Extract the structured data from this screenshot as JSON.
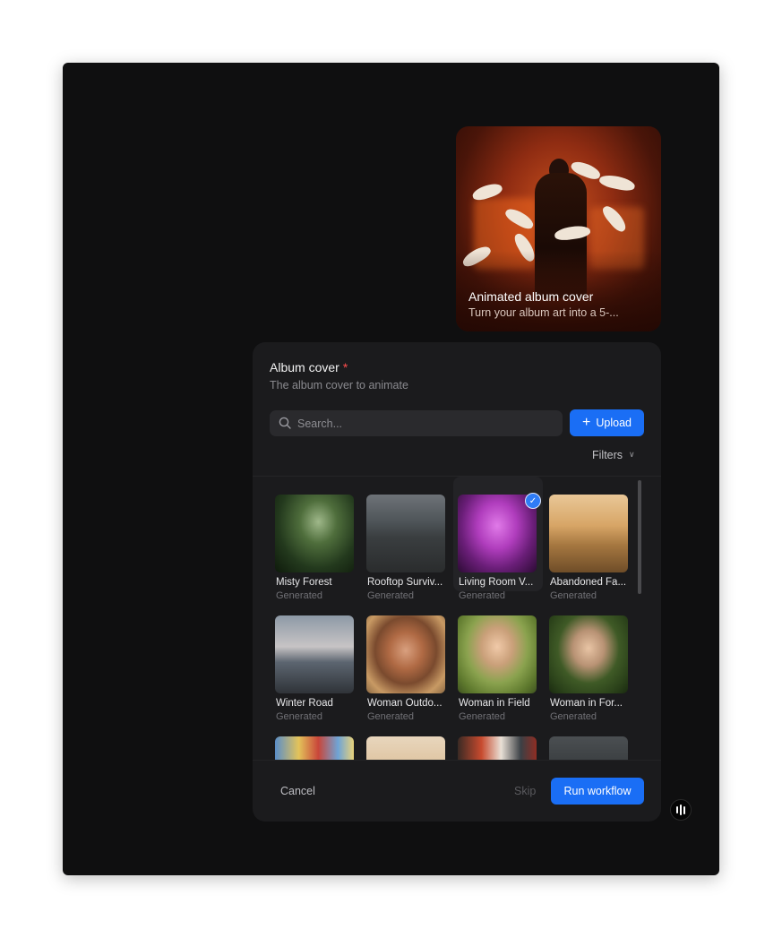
{
  "hero": {
    "title": "Animated album cover",
    "subtitle": "Turn your album art into a 5-..."
  },
  "form": {
    "field_label": "Album cover",
    "required_mark": "*",
    "field_description": "The album cover to animate",
    "search_placeholder": "Search...",
    "upload_label": "Upload",
    "filters_label": "Filters"
  },
  "gallery": {
    "items": [
      {
        "name": "Misty Forest",
        "source": "Generated",
        "selected": false,
        "icon": "forest-thumbnail"
      },
      {
        "name": "Rooftop Surviv...",
        "source": "Generated",
        "selected": false,
        "icon": "rooftop-thumbnail"
      },
      {
        "name": "Living Room V...",
        "source": "Generated",
        "selected": true,
        "icon": "living-room-thumbnail"
      },
      {
        "name": "Abandoned Fa...",
        "source": "Generated",
        "selected": false,
        "icon": "farmhouse-thumbnail"
      },
      {
        "name": "Winter Road",
        "source": "Generated",
        "selected": false,
        "icon": "road-thumbnail"
      },
      {
        "name": "Woman Outdo...",
        "source": "Generated",
        "selected": false,
        "icon": "portrait-thumbnail"
      },
      {
        "name": "Woman in Field",
        "source": "Generated",
        "selected": false,
        "icon": "portrait-thumbnail"
      },
      {
        "name": "Woman in For...",
        "source": "Generated",
        "selected": false,
        "icon": "portrait-thumbnail"
      },
      {
        "name": "",
        "source": "",
        "selected": false,
        "icon": "carnival-thumbnail"
      },
      {
        "name": "",
        "source": "",
        "selected": false,
        "icon": "sunset-thumbnail"
      },
      {
        "name": "",
        "source": "",
        "selected": false,
        "icon": "street-thumbnail"
      },
      {
        "name": "",
        "source": "",
        "selected": false,
        "icon": "storm-thumbnail"
      }
    ]
  },
  "footer": {
    "cancel_label": "Cancel",
    "skip_label": "Skip",
    "run_label": "Run workflow"
  },
  "colors": {
    "accent": "#1a6ef5",
    "panel_bg": "#1b1b1d",
    "frame_bg": "#0f0f10",
    "required": "#ff4d4d"
  }
}
